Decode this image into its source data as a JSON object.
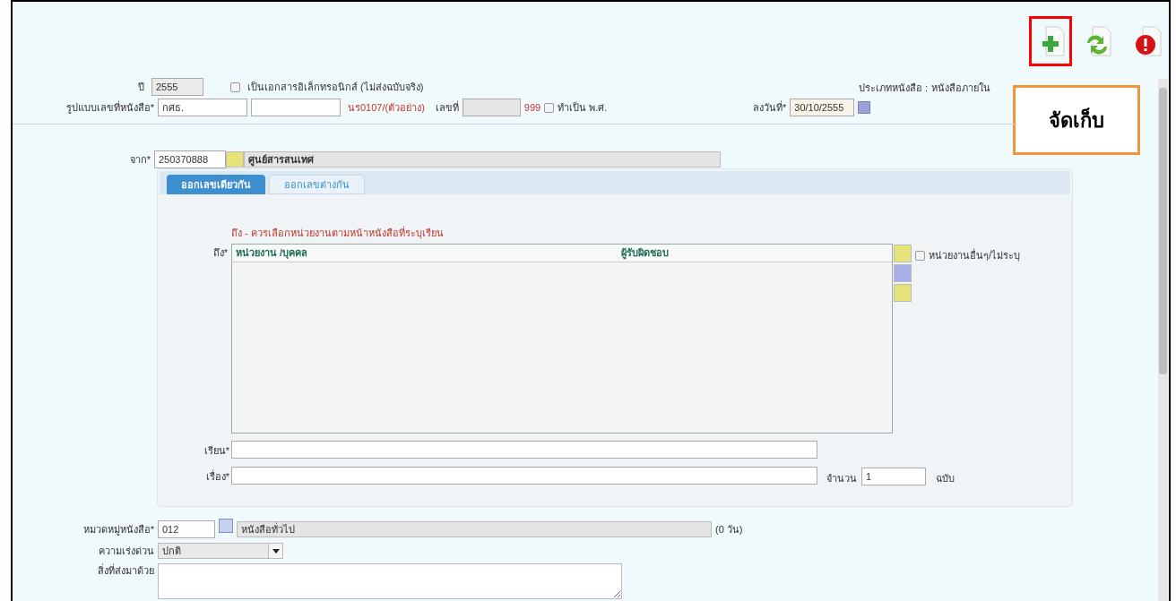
{
  "toolbar": [
    {
      "kind": "add",
      "highlighted": true
    },
    {
      "kind": "refresh",
      "highlighted": false
    },
    {
      "kind": "info",
      "highlighted": false
    }
  ],
  "callout": {
    "text": "จัดเก็บ"
  },
  "year": {
    "label": "ปี",
    "value": "2555"
  },
  "electronic": {
    "label": "เป็นเอกสารอิเล็กทรอนิกส์ (ไม่ส่งฉบับจริง)",
    "checked": false
  },
  "doc_type": {
    "label": "ประเภทหนังสือ :",
    "value": "หนังสือภายใน"
  },
  "number_format": {
    "label": "รูปแบบเลขที่หนังสือ*",
    "prefix": "กศธ.",
    "example": "นร0107/(ตัวอย่าง)",
    "number_label": "เลขที่",
    "suffix": "999",
    "be_label": "ทำเป็น พ.ศ.",
    "be_checked": false
  },
  "date": {
    "label": "ลงวันที่*",
    "value": "30/10/2555"
  },
  "from": {
    "label": "จาก*",
    "code": "250370888",
    "name": "ศูนย์สารสนเทศ"
  },
  "tabs": [
    {
      "label": "ออกเลขเดียวกัน",
      "selected": true
    },
    {
      "label": "ออกเลขต่างกัน",
      "selected": false
    }
  ],
  "note": "ถึง - ควรเลือกหน่วยงานตามหน้าหนังสือที่ระบุเรียน",
  "to": {
    "label": "ถึง*",
    "columns": [
      "หน่วยงาน /บุคคล",
      "ผู้รับผิดชอบ"
    ],
    "other_label": "หน่วยงานอื่นๆ/ไม่ระบุ",
    "other_checked": false
  },
  "dear": {
    "label": "เรียน*"
  },
  "subject": {
    "label": "เรื่อง*"
  },
  "copies": {
    "label": "จำนวน",
    "value": "1",
    "unit": "ฉบับ"
  },
  "category": {
    "label": "หมวดหมู่หนังสือ*",
    "code": "012",
    "name": "หนังสือทั่วไป",
    "days": "(0 วัน)"
  },
  "urgency": {
    "label": "ความเร่งด่วน",
    "value": "ปกติ"
  },
  "attachments": {
    "label": "สิ่งที่ส่งมาด้วย"
  }
}
